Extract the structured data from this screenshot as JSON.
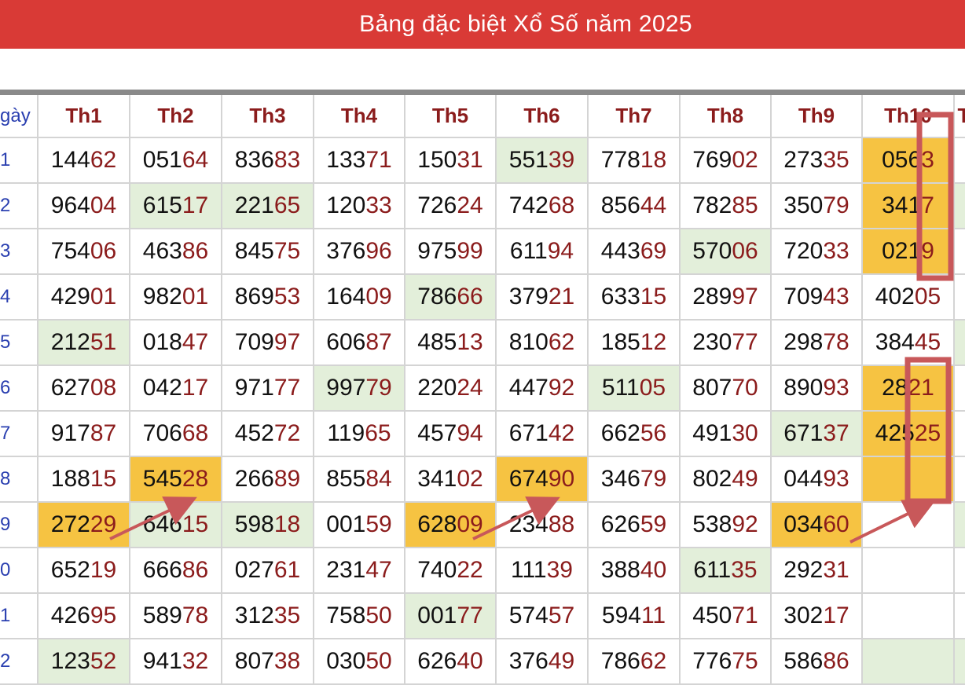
{
  "title": "Bảng đặc biệt Xổ Số năm 2025",
  "day_header": "gày",
  "months": [
    "Th1",
    "Th2",
    "Th3",
    "Th4",
    "Th5",
    "Th6",
    "Th7",
    "Th8",
    "Th9",
    "Th10",
    "T"
  ],
  "day_labels": [
    "1",
    "2",
    "3",
    "4",
    "5",
    "6",
    "7",
    "8",
    "9",
    "0",
    "1",
    "2"
  ],
  "rows": [
    [
      "14462",
      "05164",
      "83683",
      "13371",
      "15031",
      "55139",
      "77818",
      "76902",
      "27335",
      "056 3",
      ""
    ],
    [
      "96404",
      "61517",
      "22165",
      "12033",
      "72624",
      "74268",
      "85644",
      "78285",
      "35079",
      "341 7",
      ""
    ],
    [
      "75406",
      "46386",
      "84575",
      "37696",
      "97599",
      "61194",
      "44369",
      "57006",
      "72033",
      "021 9",
      ""
    ],
    [
      "42901",
      "98201",
      "86953",
      "16409",
      "78666",
      "37921",
      "63315",
      "28997",
      "70943",
      "40205",
      ""
    ],
    [
      "21251",
      "01847",
      "70997",
      "60687",
      "48513",
      "81062",
      "18512",
      "23077",
      "29878",
      "38445",
      ""
    ],
    [
      "62708",
      "04217",
      "97177",
      "99779",
      "22024",
      "44792",
      "51105",
      "80770",
      "89093",
      "28 21",
      ""
    ],
    [
      "91787",
      "70668",
      "45272",
      "11965",
      "45794",
      "67142",
      "66256",
      "49130",
      "67137",
      "42525",
      ""
    ],
    [
      "18815",
      "54528",
      "26689",
      "85584",
      "34102",
      "67490",
      "34679",
      "80249",
      "04493",
      "",
      ""
    ],
    [
      "27229",
      "64615",
      "59818",
      "00159",
      "62809",
      "23488",
      "62659",
      "53892",
      "03460",
      "",
      ""
    ],
    [
      "65219",
      "66686",
      "02761",
      "23147",
      "74022",
      "11139",
      "38840",
      "61135",
      "29231",
      "",
      ""
    ],
    [
      "42695",
      "58978",
      "31235",
      "75850",
      "00177",
      "57457",
      "59411",
      "45071",
      "30217",
      "",
      ""
    ],
    [
      "12352",
      "94132",
      "80738",
      "03050",
      "62640",
      "37649",
      "78662",
      "77675",
      "58686",
      "",
      ""
    ]
  ],
  "green_cells": [
    "0-5",
    "1-1",
    "1-2",
    "2-7",
    "3-4",
    "4-0",
    "5-3",
    "5-6",
    "6-8",
    "8-1",
    "8-2",
    "9-7",
    "10-4",
    "11-0",
    "11-9",
    "11-10",
    "1-10",
    "4-10",
    "8-10"
  ],
  "yellow_cells": [
    "0-9",
    "1-9",
    "2-9",
    "5-9",
    "6-9",
    "7-9",
    "7-1",
    "7-5",
    "8-0",
    "8-4",
    "8-8"
  ],
  "colors": {
    "header_bg": "#d93a36",
    "highlight_yellow": "#f6c342",
    "highlight_green": "#e3efda",
    "annotation": "#c8585a"
  }
}
